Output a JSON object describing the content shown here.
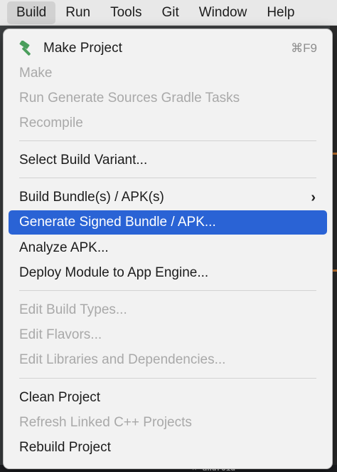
{
  "menubar": {
    "items": [
      "Build",
      "Run",
      "Tools",
      "Git",
      "Window",
      "Help"
    ]
  },
  "menu": {
    "make_project": {
      "label": "Make Project",
      "shortcut": "⌘F9"
    },
    "make": "Make",
    "run_generate_sources": "Run Generate Sources Gradle Tasks",
    "recompile": "Recompile",
    "select_build_variant": "Select Build Variant...",
    "build_bundles": "Build Bundle(s) / APK(s)",
    "generate_signed": "Generate Signed Bundle / APK...",
    "analyze_apk": "Analyze APK...",
    "deploy_module": "Deploy Module to App Engine...",
    "edit_build_types": "Edit Build Types...",
    "edit_flavors": "Edit Flavors...",
    "edit_libraries": "Edit Libraries and Dependencies...",
    "clean_project": "Clean Project",
    "refresh_linked": "Refresh Linked C++ Projects",
    "rebuild_project": "Rebuild Project"
  },
  "background": {
    "tab_text": "android"
  },
  "colors": {
    "highlight": "#2a63d5",
    "hammer": "#4a9e5c",
    "disabled_text": "#a9a9a9"
  },
  "icons": {
    "make_project": "hammer-icon",
    "submenu": "chevron-right-icon",
    "close_tab": "close-icon"
  }
}
